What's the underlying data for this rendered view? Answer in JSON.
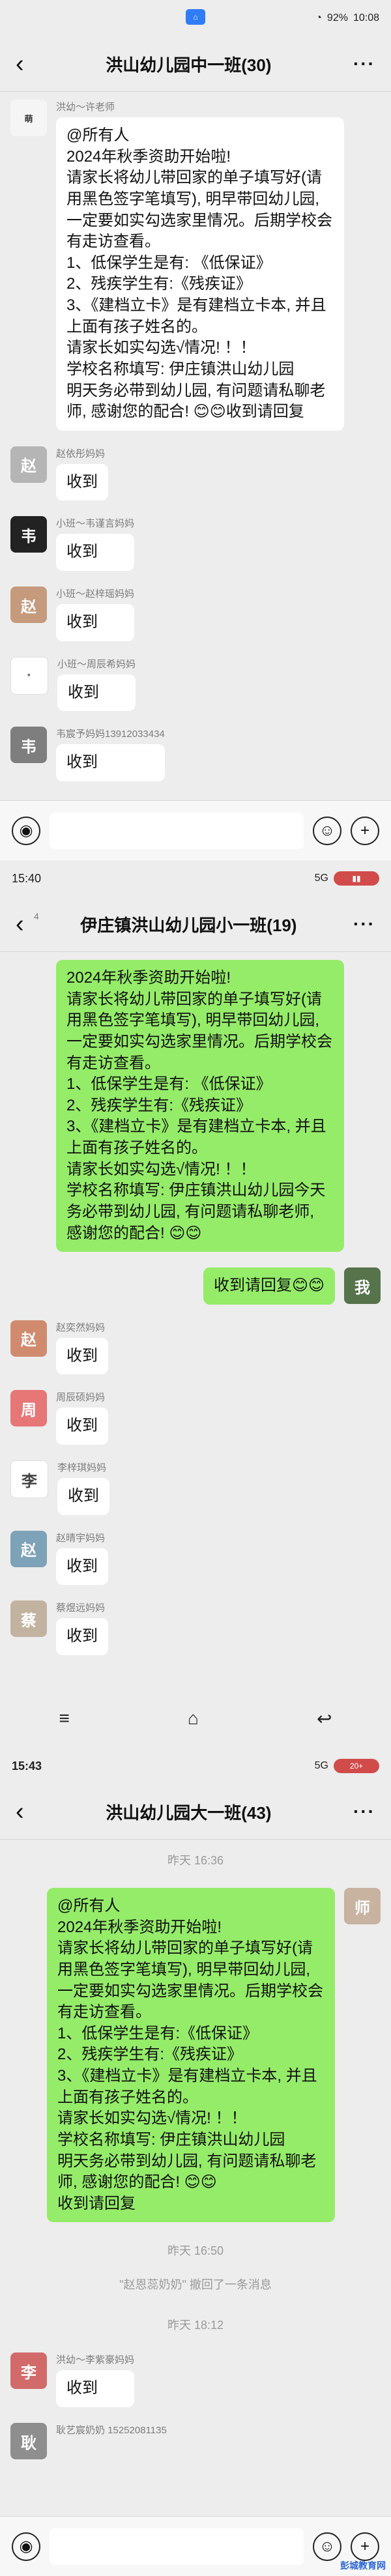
{
  "screens": [
    {
      "status": {
        "time": "10:08",
        "battery": "92%"
      },
      "chat_title": "洪山幼儿园中一班(30)",
      "announcement": {
        "sender": "洪幼～许老师",
        "text": "@所有人\n2024年秋季资助开始啦!\n请家长将幼儿带回家的单子填写好(请用黑色签字笔填写), 明早带回幼儿园, 一定要如实勾选家里情况。后期学校会有走访查看。\n1、低保学生是有: 《低保证》\n2、残疾学生有:《残疾证》\n3、《建档立卡》是有建档立卡本, 并且上面有孩子姓名的。\n请家长如实勾选√情况! ！！\n学校名称填写: 伊庄镇洪山幼儿园\n明天务必带到幼儿园, 有问题请私聊老师, 感谢您的配合! 😊😊收到请回复"
      },
      "replies": [
        {
          "name": "赵依彤妈妈",
          "text": "收到"
        },
        {
          "name": "小班～韦谨言妈妈",
          "text": "收到"
        },
        {
          "name": "小班～赵梓瑶妈妈",
          "text": "收到"
        },
        {
          "name": "小班～周辰希妈妈",
          "text": "收到"
        },
        {
          "name": "韦宸予妈妈13912033434",
          "text": "收到"
        }
      ]
    },
    {
      "status": {
        "time": "15:40",
        "battery": "5G"
      },
      "chat_title": "伊庄镇洪山幼儿园小一班(19)",
      "back_count": "4",
      "announcement_text": "2024年秋季资助开始啦!\n请家长将幼儿带回家的单子填写好(请用黑色签字笔填写), 明早带回幼儿园, 一定要如实勾选家里情况。后期学校会有走访查看。\n1、低保学生是有: 《低保证》\n2、残疾学生有:《残疾证》\n3、《建档立卡》是有建档立卡本, 并且上面有孩子姓名的。\n请家长如实勾选√情况! ！！\n学校名称填写: 伊庄镇洪山幼儿园今天务必带到幼儿园, 有问题请私聊老师, 感谢您的配合! 😊😊",
      "self_reply": "收到请回复😊😊",
      "replies": [
        {
          "name": "赵奕然妈妈",
          "text": "收到"
        },
        {
          "name": "周辰硕妈妈",
          "text": "收到"
        },
        {
          "name": "李梓琪妈妈",
          "text": "收到"
        },
        {
          "name": "赵晴宇妈妈",
          "text": "收到"
        },
        {
          "name": "蔡煜远妈妈",
          "text": "收到"
        }
      ]
    },
    {
      "status": {
        "time": "15:43",
        "network": "5G",
        "battery": "20+"
      },
      "chat_title": "洪山幼儿园大一班(43)",
      "time_1": "昨天 16:36",
      "announcement": {
        "text": "@所有人\n2024年秋季资助开始啦!\n请家长将幼儿带回家的单子填写好(请用黑色签字笔填写), 明早带回幼儿园, 一定要如实勾选家里情况。后期学校会有走访查看。\n1、低保学生是有:《低保证》\n2、残疾学生有:《残疾证》\n3、《建档立卡》是有建档立卡本, 并且上面有孩子姓名的。\n请家长如实勾选√情况! ！！\n学校名称填写: 伊庄镇洪山幼儿园\n明天务必带到幼儿园, 有问题请私聊老师, 感谢您的配合! 😊😊\n收到请回复"
      },
      "time_2": "昨天 16:50",
      "recall_notice": "\"赵恩蕊奶奶\" 撤回了一条消息",
      "time_3": "昨天 18:12",
      "replies": [
        {
          "name": "洪幼～李紫豪妈妈",
          "text": "收到"
        },
        {
          "name": "耿艺宸奶奶 15252081135",
          "text": ""
        }
      ]
    }
  ],
  "watermark": "彭城教育网"
}
